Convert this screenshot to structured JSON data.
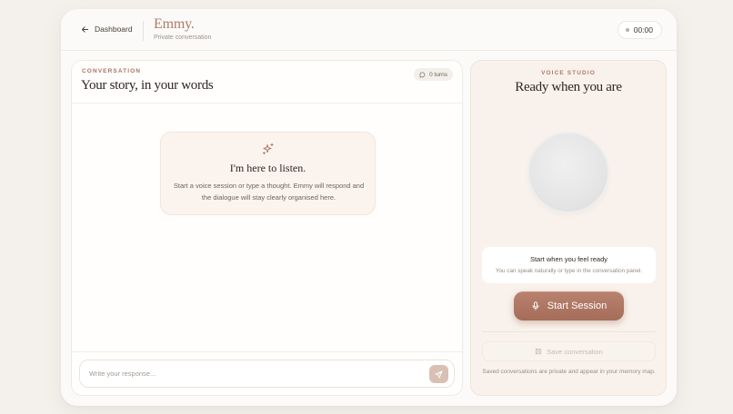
{
  "header": {
    "back_label": "Dashboard",
    "brand": "Emmy.",
    "subtitle": "Private conversation",
    "timer": "00:00"
  },
  "conversation": {
    "eyebrow": "CONVERSATION",
    "title": "Your story, in your words",
    "turns": "0 turns",
    "empty_title": "I'm here to listen.",
    "empty_body": "Start a voice session or type a thought. Emmy will respond and the dialogue will stay clearly organised here.",
    "input_placeholder": "Write your response..."
  },
  "studio": {
    "eyebrow": "VOICE STUDIO",
    "title": "Ready when you are",
    "ready_title": "Start when you feel ready",
    "ready_sub": "You can speak naturally or type in the conversation panel.",
    "start_label": "Start Session",
    "save_label": "Save conversation",
    "save_note": "Saved conversations are private and appear in your memory map."
  },
  "colors": {
    "accent": "#a8735f",
    "background": "#f4f1ec",
    "button": "#b07a68"
  },
  "icons": [
    "arrow-left-icon",
    "chat-bubble-icon",
    "sparkle-icon",
    "send-icon",
    "microphone-icon",
    "save-icon"
  ]
}
